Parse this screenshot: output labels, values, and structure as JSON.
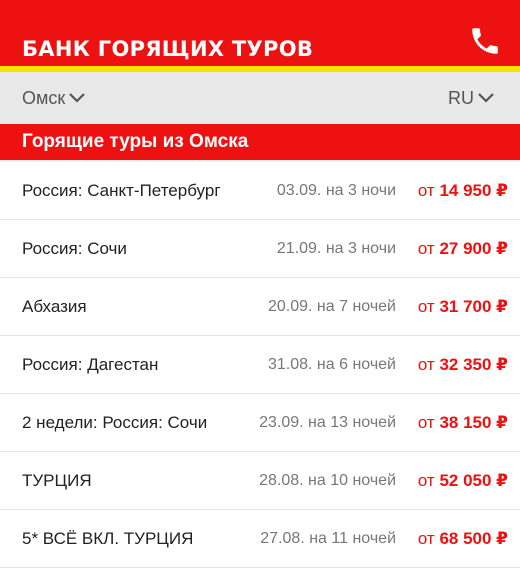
{
  "header": {
    "brand": "БАНК ГОРЯЩИХ ТУРОВ",
    "phone_icon": "phone-icon"
  },
  "selectors": {
    "city": "Омск",
    "language": "RU"
  },
  "banner": {
    "title": "Горящие туры из Омска"
  },
  "tours": [
    {
      "destination": "Россия: Санкт-Петербург",
      "dates": "03.09. на 3 ночи",
      "price_prefix": "от",
      "price": "14 950 ₽"
    },
    {
      "destination": "Россия: Сочи",
      "dates": "21.09. на 3 ночи",
      "price_prefix": "от",
      "price": "27 900 ₽"
    },
    {
      "destination": "Абхазия",
      "dates": "20.09. на 7 ночей",
      "price_prefix": "от",
      "price": "31 700 ₽"
    },
    {
      "destination": "Россия: Дагестан",
      "dates": "31.08. на 6 ночей",
      "price_prefix": "от",
      "price": "32 350 ₽"
    },
    {
      "destination": "2 недели: Россия: Сочи",
      "dates": "23.09. на 13 ночей",
      "price_prefix": "от",
      "price": "38 150 ₽"
    },
    {
      "destination": "ТУРЦИЯ",
      "dates": "28.08. на 10 ночей",
      "price_prefix": "от",
      "price": "52 050 ₽"
    },
    {
      "destination": "5* ВСЁ ВКЛ. ТУРЦИЯ",
      "dates": "27.08. на 11 ночей",
      "price_prefix": "от",
      "price": "68 500 ₽"
    }
  ],
  "colors": {
    "brand_red": "#ee1111",
    "accent_yellow": "#f5e400",
    "selector_bg": "#e9e9e9"
  }
}
